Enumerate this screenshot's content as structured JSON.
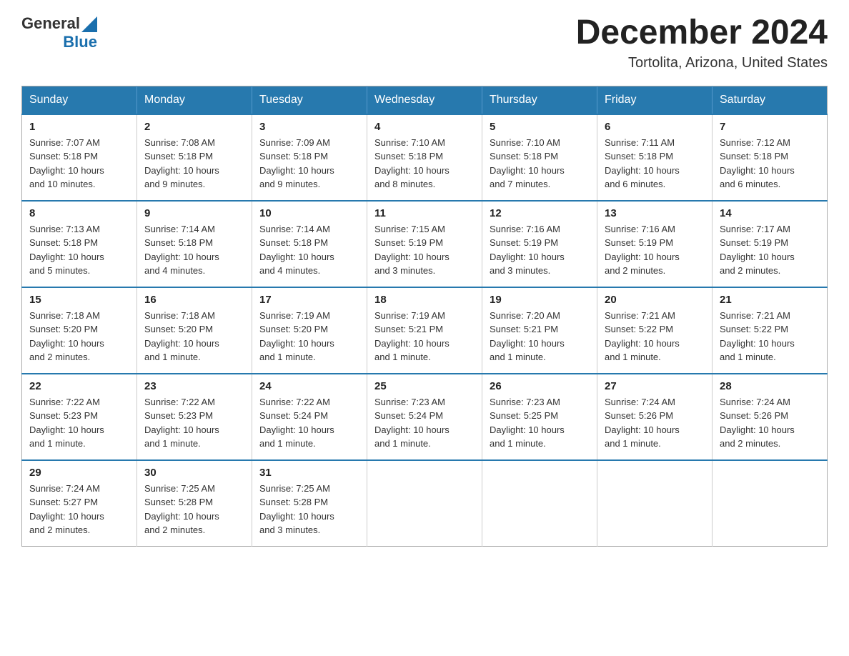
{
  "header": {
    "logo_general": "General",
    "logo_blue": "Blue",
    "month_title": "December 2024",
    "location": "Tortolita, Arizona, United States"
  },
  "days_of_week": [
    "Sunday",
    "Monday",
    "Tuesday",
    "Wednesday",
    "Thursday",
    "Friday",
    "Saturday"
  ],
  "weeks": [
    [
      {
        "day": "1",
        "sunrise": "7:07 AM",
        "sunset": "5:18 PM",
        "daylight": "10 hours and 10 minutes."
      },
      {
        "day": "2",
        "sunrise": "7:08 AM",
        "sunset": "5:18 PM",
        "daylight": "10 hours and 9 minutes."
      },
      {
        "day": "3",
        "sunrise": "7:09 AM",
        "sunset": "5:18 PM",
        "daylight": "10 hours and 9 minutes."
      },
      {
        "day": "4",
        "sunrise": "7:10 AM",
        "sunset": "5:18 PM",
        "daylight": "10 hours and 8 minutes."
      },
      {
        "day": "5",
        "sunrise": "7:10 AM",
        "sunset": "5:18 PM",
        "daylight": "10 hours and 7 minutes."
      },
      {
        "day": "6",
        "sunrise": "7:11 AM",
        "sunset": "5:18 PM",
        "daylight": "10 hours and 6 minutes."
      },
      {
        "day": "7",
        "sunrise": "7:12 AM",
        "sunset": "5:18 PM",
        "daylight": "10 hours and 6 minutes."
      }
    ],
    [
      {
        "day": "8",
        "sunrise": "7:13 AM",
        "sunset": "5:18 PM",
        "daylight": "10 hours and 5 minutes."
      },
      {
        "day": "9",
        "sunrise": "7:14 AM",
        "sunset": "5:18 PM",
        "daylight": "10 hours and 4 minutes."
      },
      {
        "day": "10",
        "sunrise": "7:14 AM",
        "sunset": "5:18 PM",
        "daylight": "10 hours and 4 minutes."
      },
      {
        "day": "11",
        "sunrise": "7:15 AM",
        "sunset": "5:19 PM",
        "daylight": "10 hours and 3 minutes."
      },
      {
        "day": "12",
        "sunrise": "7:16 AM",
        "sunset": "5:19 PM",
        "daylight": "10 hours and 3 minutes."
      },
      {
        "day": "13",
        "sunrise": "7:16 AM",
        "sunset": "5:19 PM",
        "daylight": "10 hours and 2 minutes."
      },
      {
        "day": "14",
        "sunrise": "7:17 AM",
        "sunset": "5:19 PM",
        "daylight": "10 hours and 2 minutes."
      }
    ],
    [
      {
        "day": "15",
        "sunrise": "7:18 AM",
        "sunset": "5:20 PM",
        "daylight": "10 hours and 2 minutes."
      },
      {
        "day": "16",
        "sunrise": "7:18 AM",
        "sunset": "5:20 PM",
        "daylight": "10 hours and 1 minute."
      },
      {
        "day": "17",
        "sunrise": "7:19 AM",
        "sunset": "5:20 PM",
        "daylight": "10 hours and 1 minute."
      },
      {
        "day": "18",
        "sunrise": "7:19 AM",
        "sunset": "5:21 PM",
        "daylight": "10 hours and 1 minute."
      },
      {
        "day": "19",
        "sunrise": "7:20 AM",
        "sunset": "5:21 PM",
        "daylight": "10 hours and 1 minute."
      },
      {
        "day": "20",
        "sunrise": "7:21 AM",
        "sunset": "5:22 PM",
        "daylight": "10 hours and 1 minute."
      },
      {
        "day": "21",
        "sunrise": "7:21 AM",
        "sunset": "5:22 PM",
        "daylight": "10 hours and 1 minute."
      }
    ],
    [
      {
        "day": "22",
        "sunrise": "7:22 AM",
        "sunset": "5:23 PM",
        "daylight": "10 hours and 1 minute."
      },
      {
        "day": "23",
        "sunrise": "7:22 AM",
        "sunset": "5:23 PM",
        "daylight": "10 hours and 1 minute."
      },
      {
        "day": "24",
        "sunrise": "7:22 AM",
        "sunset": "5:24 PM",
        "daylight": "10 hours and 1 minute."
      },
      {
        "day": "25",
        "sunrise": "7:23 AM",
        "sunset": "5:24 PM",
        "daylight": "10 hours and 1 minute."
      },
      {
        "day": "26",
        "sunrise": "7:23 AM",
        "sunset": "5:25 PM",
        "daylight": "10 hours and 1 minute."
      },
      {
        "day": "27",
        "sunrise": "7:24 AM",
        "sunset": "5:26 PM",
        "daylight": "10 hours and 1 minute."
      },
      {
        "day": "28",
        "sunrise": "7:24 AM",
        "sunset": "5:26 PM",
        "daylight": "10 hours and 2 minutes."
      }
    ],
    [
      {
        "day": "29",
        "sunrise": "7:24 AM",
        "sunset": "5:27 PM",
        "daylight": "10 hours and 2 minutes."
      },
      {
        "day": "30",
        "sunrise": "7:25 AM",
        "sunset": "5:28 PM",
        "daylight": "10 hours and 2 minutes."
      },
      {
        "day": "31",
        "sunrise": "7:25 AM",
        "sunset": "5:28 PM",
        "daylight": "10 hours and 3 minutes."
      },
      null,
      null,
      null,
      null
    ]
  ],
  "labels": {
    "sunrise": "Sunrise:",
    "sunset": "Sunset:",
    "daylight": "Daylight:"
  }
}
